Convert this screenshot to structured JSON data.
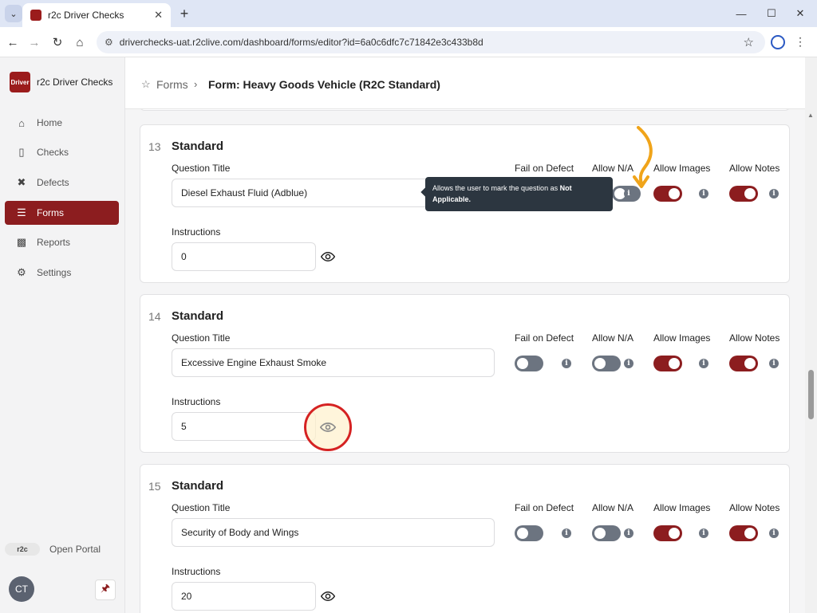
{
  "browser": {
    "tab_title": "r2c Driver Checks",
    "url": "driverchecks-uat.r2clive.com/dashboard/forms/editor?id=6a0c6dfc7c71842e3c433b8d"
  },
  "app": {
    "brand_name": "r2c Driver Checks",
    "brand_logo_text": "Driver",
    "nav": [
      {
        "label": "Home",
        "icon": "home-icon"
      },
      {
        "label": "Checks",
        "icon": "clipboard-icon"
      },
      {
        "label": "Defects",
        "icon": "tools-icon"
      },
      {
        "label": "Forms",
        "icon": "list-icon"
      },
      {
        "label": "Reports",
        "icon": "chart-icon"
      },
      {
        "label": "Settings",
        "icon": "gear-icon"
      }
    ],
    "open_portal": "Open Portal",
    "r2c_logo_text": "r2c",
    "user_initials": "CT"
  },
  "breadcrumb": {
    "root": "Forms",
    "current": "Form: Heavy Goods Vehicle (R2C Standard)"
  },
  "labels": {
    "question_title": "Question Title",
    "instructions": "Instructions",
    "fail_on_defect": "Fail on Defect",
    "allow_na": "Allow N/A",
    "allow_images": "Allow Images",
    "allow_notes": "Allow Notes"
  },
  "questions": [
    {
      "number": "13",
      "type": "Standard",
      "title": "Diesel Exhaust Fluid (Adblue)",
      "instructions": "0",
      "fail_on_defect": false,
      "allow_na": false,
      "allow_images": true,
      "allow_notes": true
    },
    {
      "number": "14",
      "type": "Standard",
      "title": "Excessive Engine Exhaust Smoke",
      "instructions": "5",
      "fail_on_defect": false,
      "allow_na": false,
      "allow_images": true,
      "allow_notes": true
    },
    {
      "number": "15",
      "type": "Standard",
      "title": "Security of Body and Wings",
      "instructions": "20",
      "fail_on_defect": false,
      "allow_na": false,
      "allow_images": true,
      "allow_notes": true
    }
  ],
  "tooltip": {
    "text": "Allows the user to mark the question as ",
    "bold": "Not Applicable."
  },
  "colors": {
    "accent": "#8c1d1f",
    "toggle_off": "#6c7480",
    "highlight": "#d52222",
    "arrow": "#f0a41a"
  }
}
